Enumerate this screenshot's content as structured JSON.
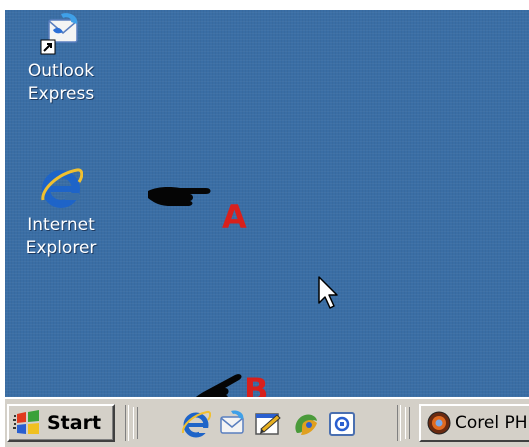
{
  "desktop": {
    "background_color": "#3a6ea5",
    "icons": [
      {
        "label": "Outlook\nExpress",
        "icon": "outlook-express-icon",
        "shortcut": true
      },
      {
        "label": "Internet\nExplorer",
        "icon": "internet-explorer-icon",
        "shortcut": false
      }
    ]
  },
  "annotations": {
    "a_label": "A",
    "b_label": "B",
    "color": "#d8201c"
  },
  "taskbar": {
    "start_label": "Start",
    "quick_launch": [
      "internet-explorer-icon",
      "outlook-express-icon",
      "show-desktop-icon",
      "media-player-icon",
      "channels-icon"
    ],
    "tasks": [
      {
        "label": "Corel PH",
        "icon": "corel-photo-paint-icon"
      }
    ]
  }
}
